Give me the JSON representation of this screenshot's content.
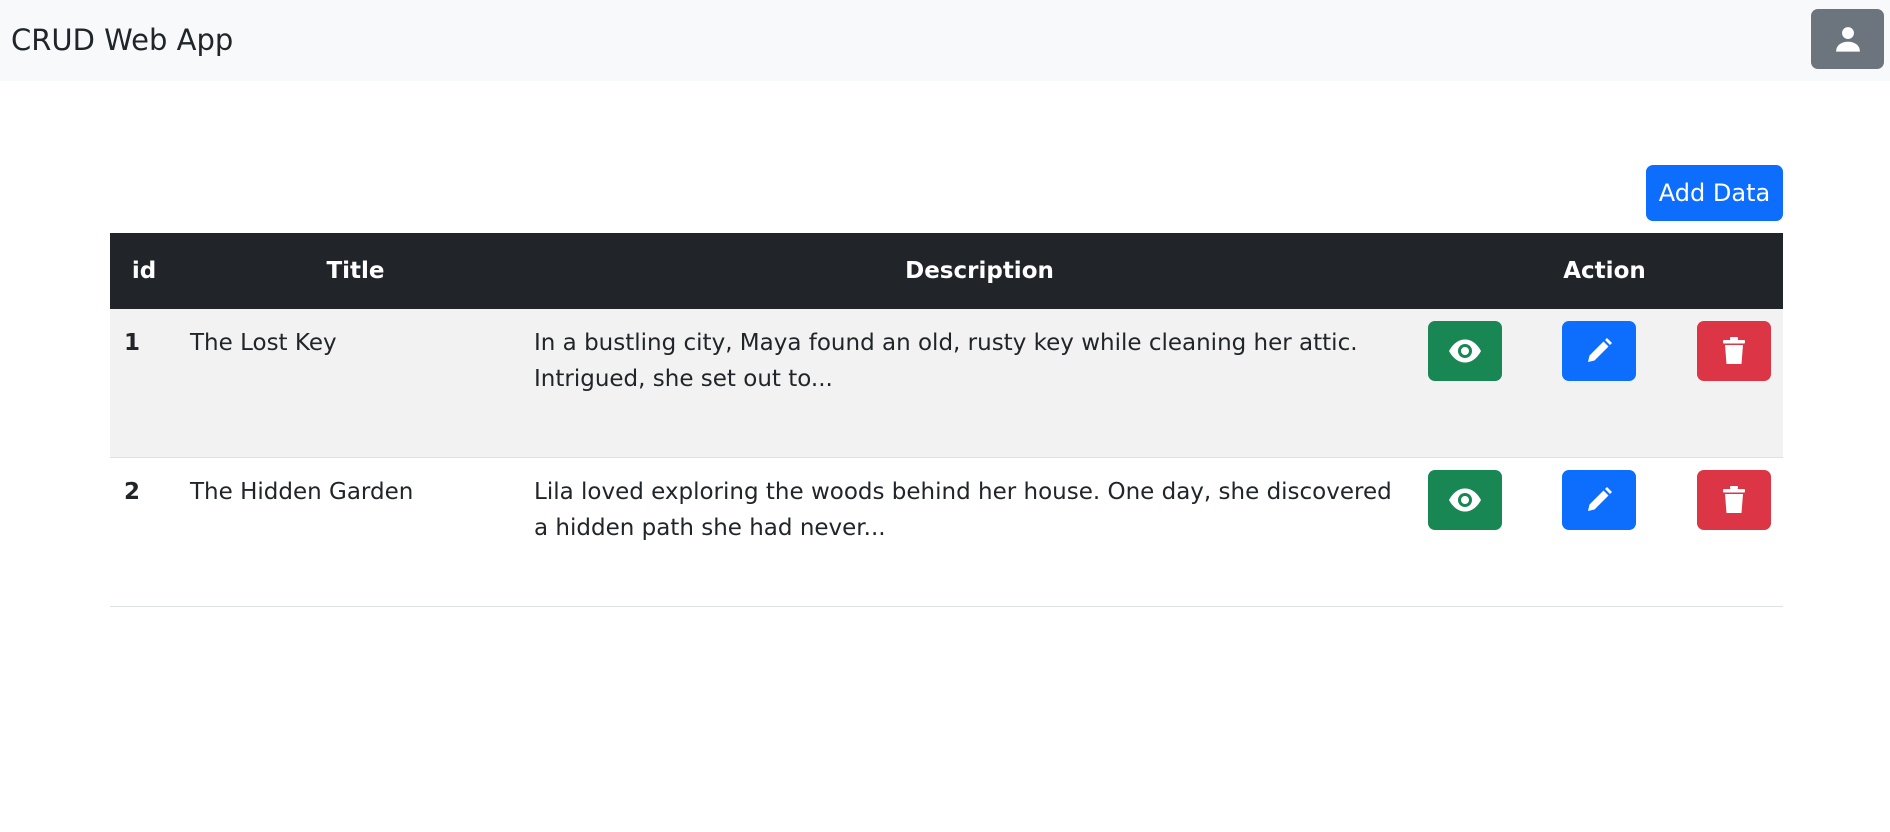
{
  "navbar": {
    "brand": "CRUD Web App",
    "user_icon": "user-icon"
  },
  "toolbar": {
    "add_label": "Add Data"
  },
  "table": {
    "headers": {
      "id": "id",
      "title": "Title",
      "description": "Description",
      "action": "Action"
    },
    "rows": [
      {
        "id": "1",
        "title": "The Lost Key",
        "description": "In a bustling city, Maya found an old, rusty key while cleaning her attic. Intrigued, she set out to..."
      },
      {
        "id": "2",
        "title": "The Hidden Garden",
        "description": "Lila loved exploring the woods behind her house. One day, she discovered a hidden path she had never..."
      }
    ],
    "action_icons": [
      "eye-icon",
      "pencil-icon",
      "trash-icon"
    ]
  },
  "colors": {
    "navbar_bg": "#f8f9fa",
    "primary": "#0d6efd",
    "success": "#198754",
    "danger": "#dc3545",
    "secondary": "#6c757d",
    "table_header_bg": "#212529"
  }
}
